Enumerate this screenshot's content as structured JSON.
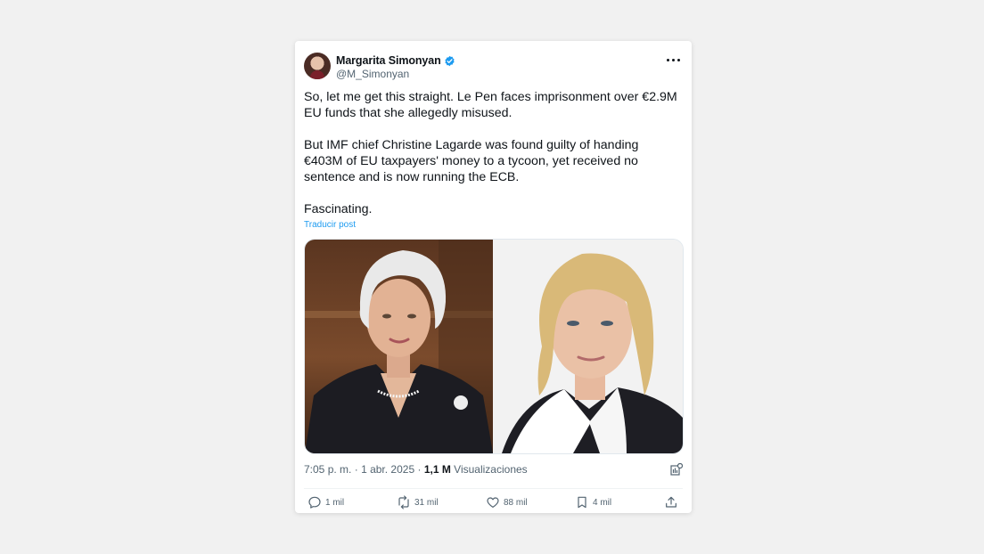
{
  "author": {
    "name": "Margarita Simonyan",
    "handle": "@M_Simonyan"
  },
  "post": {
    "paragraph1": "So, let me get this straight. Le Pen faces imprisonment over €2.9M EU funds that she allegedly misused.",
    "paragraph2": "But IMF chief Christine Lagarde was found guilty of handing €403M of EU taxpayers' money to a tycoon, yet received no sentence and is now running the ECB.",
    "paragraph3": "Fascinating.",
    "translate_label": "Traducir post"
  },
  "meta": {
    "time": "7:05 p. m.",
    "date": "1 abr. 2025",
    "views_count": "1,1 M",
    "views_label": "Visualizaciones"
  },
  "actions": {
    "replies": "1 mil",
    "reposts": "31 mil",
    "likes": "88 mil",
    "bookmarks": "4 mil"
  },
  "colors": {
    "accent": "#1d9bf0",
    "text": "#0f1419",
    "muted": "#536471",
    "background": "#f1f1f1"
  },
  "icons": [
    "verified-badge-icon",
    "more-options-icon",
    "analytics-icon",
    "reply-icon",
    "repost-icon",
    "like-icon",
    "bookmark-icon",
    "share-icon"
  ]
}
